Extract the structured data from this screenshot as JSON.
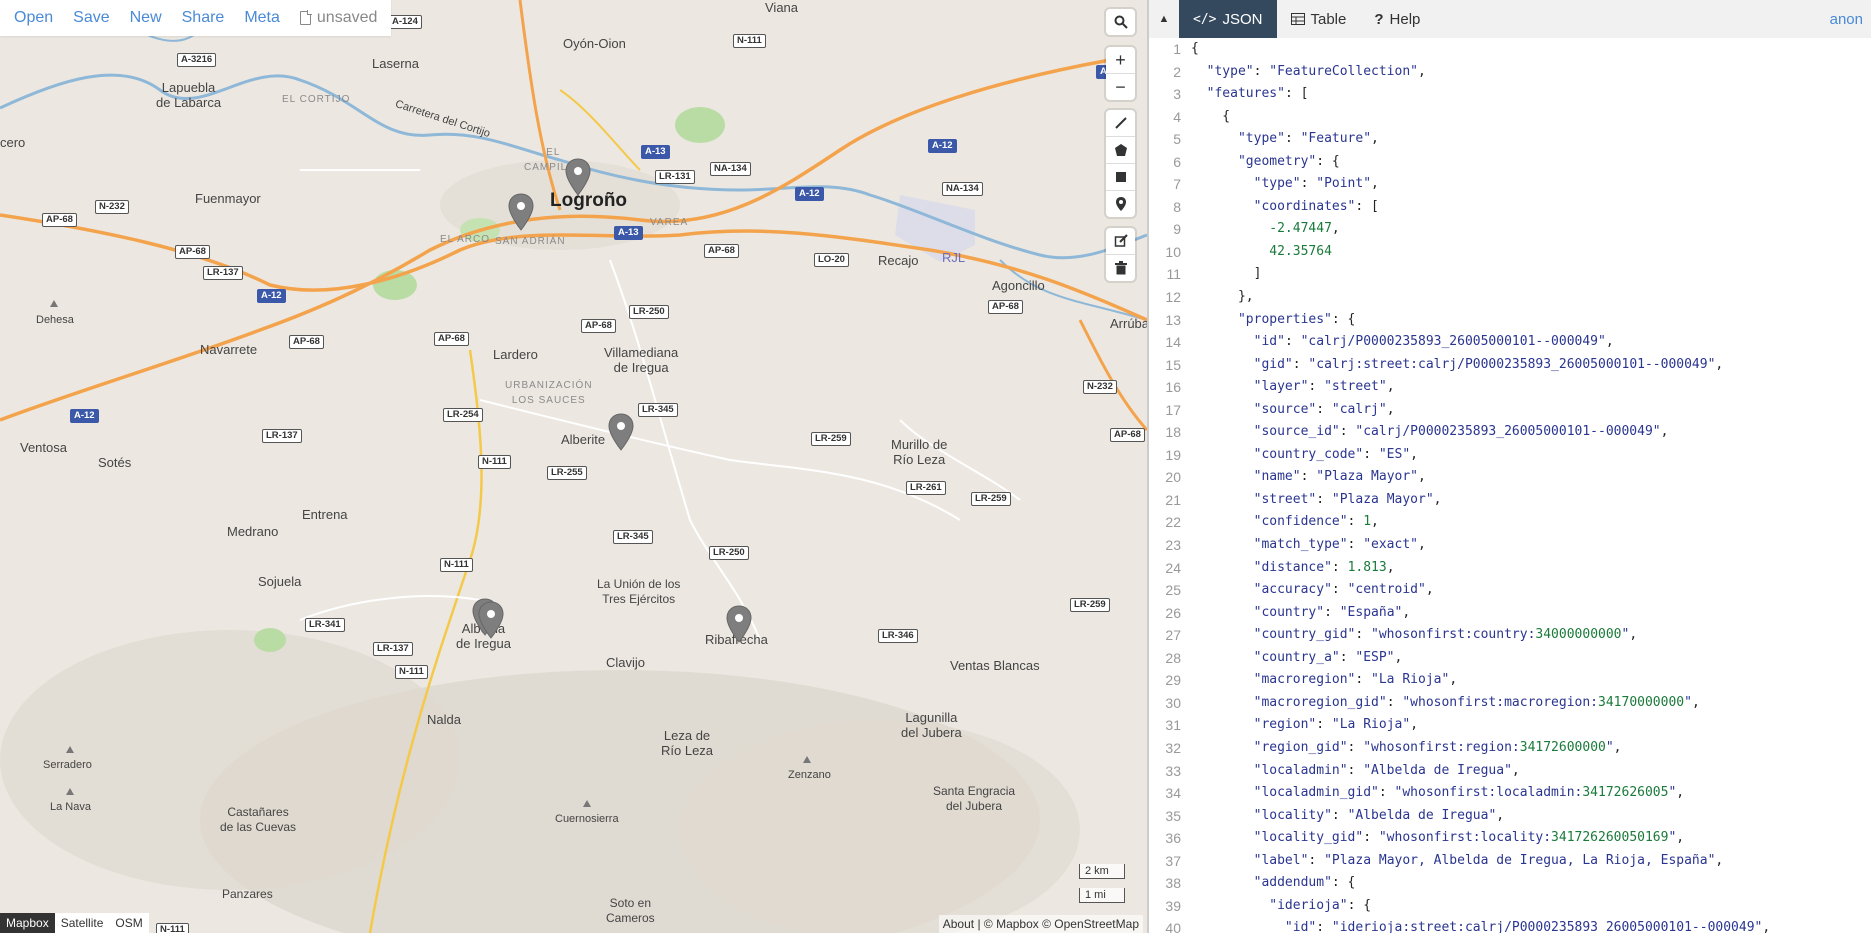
{
  "toolbar": {
    "open": "Open",
    "save": "Save",
    "new": "New",
    "share": "Share",
    "meta": "Meta",
    "unsaved": "unsaved"
  },
  "map": {
    "places": {
      "logrono": "Logroño",
      "viana": "Viana",
      "oyon": "Oyón-Oion",
      "laserna": "Laserna",
      "lapuebla": "Lapuebla\nde Labarca",
      "elcortijo": "EL CORTIJO",
      "carretera": "Carretera del Cortijo",
      "elcampillo": "EL\nCAMPILLO",
      "varea": "VAREA",
      "elarco": "EL ARCO",
      "sanadrian": "SAN ADRIÁN",
      "fuenmayor": "Fuenmayor",
      "cero": "cero",
      "recajo": "Recajo",
      "rjl": "RJL",
      "agoncillo": "Agoncillo",
      "arrubal": "Arrúbal",
      "dehesa": "Dehesa",
      "navarrete": "Navarrete",
      "lardero": "Lardero",
      "villamediana": "Villamediana\nde Iregua",
      "urbanizacion": "URBANIZACIÓN\nLOS SAUCES",
      "alberite": "Alberite",
      "murillo": "Murillo de\nRío Leza",
      "ventosa": "Ventosa",
      "sotes": "Sotés",
      "entrena": "Entrena",
      "medrano": "Medrano",
      "sojuela": "Sojuela",
      "albelda": "Albelda\nde Iregua",
      "launion": "La Unión de los\nTres Ejércitos",
      "ribafrecha": "Ribafrecha",
      "clavijo": "Clavijo",
      "ventasblancas": "Ventas Blancas",
      "nalda": "Nalda",
      "leza": "Leza de\nRío Leza",
      "lagunilla": "Lagunilla\ndel Jubera",
      "serradero": "Serradero",
      "zenzano": "Zenzano",
      "lanava": "La Nava",
      "castanares": "Castañares\nde las Cuevas",
      "cuernosierra": "Cuernosierra",
      "santaengracia": "Santa Engracia\ndel Jubera",
      "panzares": "Panzares",
      "soto": "Soto en\nCameros"
    },
    "roads": {
      "a124": "A-124",
      "n111a": "N-111",
      "a3216": "A-3216",
      "a13a": "A-13",
      "lr131": "LR-131",
      "na134a": "NA-134",
      "a12a": "A-12",
      "a12b": "A-12",
      "na134b": "NA-134",
      "a13b": "A-13",
      "ap68a": "AP-68",
      "n232a": "N-232",
      "ap68b": "AP-68",
      "lr137a": "LR-137",
      "a12c": "A-12",
      "ap68c": "AP-68",
      "lo20": "LO-20",
      "ap68d": "AP-68",
      "lr250a": "LR-250",
      "ap68e": "AP-68",
      "ap68f": "AP-68",
      "lr345a": "LR-345",
      "lr254": "LR-254",
      "a12d": "A-12",
      "lr137b": "LR-137",
      "n111b": "N-111",
      "lr255": "LR-255",
      "lr259a": "LR-259",
      "lr261": "LR-261",
      "lr259b": "LR-259",
      "n232b": "N-232",
      "ap68g": "AP-68",
      "lr345b": "LR-345",
      "lr250b": "LR-250",
      "n111c": "N-111",
      "lr341": "LR-341",
      "lr137c": "LR-137",
      "n111d": "N-111",
      "lr346": "LR-346",
      "lr259c": "LR-259",
      "n111e": "N-111",
      "a12e": "A"
    },
    "scale": {
      "km": "2 km",
      "mi": "1 mi"
    },
    "attribution": "About | © Mapbox © OpenStreetMap",
    "layers": [
      "Mapbox",
      "Satellite",
      "OSM"
    ],
    "active_layer": "Mapbox"
  },
  "panel": {
    "tabs": [
      {
        "label": "JSON",
        "icon": "code-icon"
      },
      {
        "label": "Table",
        "icon": "table-icon"
      },
      {
        "label": "Help",
        "icon": "help-icon"
      }
    ],
    "active_tab": "JSON",
    "user": "anon",
    "lines": [
      "{",
      "  \"type\": \"FeatureCollection\",",
      "  \"features\": [",
      "    {",
      "      \"type\": \"Feature\",",
      "      \"geometry\": {",
      "        \"type\": \"Point\",",
      "        \"coordinates\": [",
      "          -2.47447,",
      "          42.35764",
      "        ]",
      "      },",
      "      \"properties\": {",
      "        \"id\": \"calrj/P0000235893_26005000101--000049\",",
      "        \"gid\": \"calrj:street:calrj/P0000235893_26005000101--000049\",",
      "        \"layer\": \"street\",",
      "        \"source\": \"calrj\",",
      "        \"source_id\": \"calrj/P0000235893_26005000101--000049\",",
      "        \"country_code\": \"ES\",",
      "        \"name\": \"Plaza Mayor\",",
      "        \"street\": \"Plaza Mayor\",",
      "        \"confidence\": 1,",
      "        \"match_type\": \"exact\",",
      "        \"distance\": 1.813,",
      "        \"accuracy\": \"centroid\",",
      "        \"country\": \"España\",",
      "        \"country_gid\": \"whosonfirst:country:34000000000\",",
      "        \"country_a\": \"ESP\",",
      "        \"macroregion\": \"La Rioja\",",
      "        \"macroregion_gid\": \"whosonfirst:macroregion:34170000000\",",
      "        \"region\": \"La Rioja\",",
      "        \"region_gid\": \"whosonfirst:region:34172600000\",",
      "        \"localadmin\": \"Albelda de Iregua\",",
      "        \"localadmin_gid\": \"whosonfirst:localadmin:34172626005\",",
      "        \"locality\": \"Albelda de Iregua\",",
      "        \"locality_gid\": \"whosonfirst:locality:341726260050169\",",
      "        \"label\": \"Plaza Mayor, Albelda de Iregua, La Rioja, España\",",
      "        \"addendum\": {",
      "          \"iderioja\": {",
      "            \"id\": \"iderioja:street:calrj/P0000235893_26005000101--000049\","
    ]
  }
}
